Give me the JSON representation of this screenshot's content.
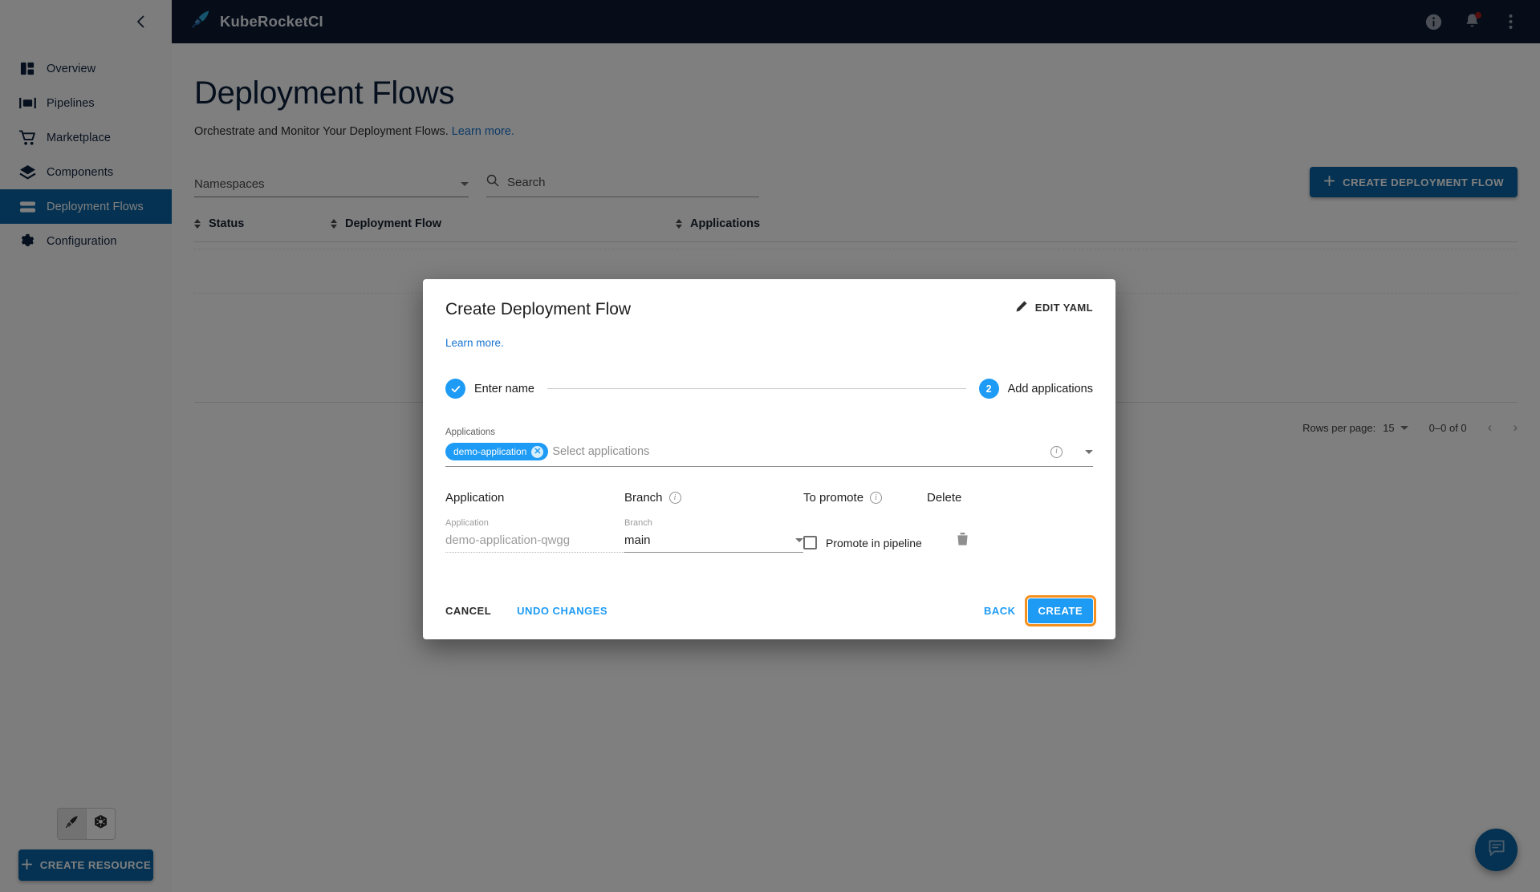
{
  "app": {
    "brand": "KubeRocketCI",
    "brand_icon": "rocket-logo-icon",
    "accent_blue": "#0a64a4",
    "bright_blue": "#1d9bf5",
    "topbar_bg": "#0c1b33",
    "highlight_orange": "#f5901e"
  },
  "topbar": {
    "info_icon": "info-icon",
    "notifications_icon": "bell-icon",
    "overflow_icon": "more-vertical-icon"
  },
  "sidebar": {
    "collapse_icon": "chevron-left-icon",
    "items": [
      {
        "label": "Overview",
        "icon": "dashboard-icon",
        "active": false
      },
      {
        "label": "Pipelines",
        "icon": "pipelines-icon",
        "active": false
      },
      {
        "label": "Marketplace",
        "icon": "cart-icon",
        "active": false
      },
      {
        "label": "Components",
        "icon": "layers-icon",
        "active": false
      },
      {
        "label": "Deployment Flows",
        "icon": "deployment-flows-icon",
        "active": true
      },
      {
        "label": "Configuration",
        "icon": "gear-icon",
        "active": false
      }
    ],
    "mode_toggle": {
      "left_icon": "rocket-mode-icon",
      "right_icon": "kubernetes-mode-icon"
    },
    "create_resource_label": "CREATE RESOURCE",
    "create_resource_icon": "plus-icon"
  },
  "page": {
    "title": "Deployment Flows",
    "subtitle": "Orchestrate and Monitor Your Deployment Flows.",
    "subtitle_link": "Learn more."
  },
  "toolbar": {
    "namespaces_label": "Namespaces",
    "search_placeholder": "Search",
    "search_icon": "search-icon",
    "create_flow_label": "CREATE DEPLOYMENT FLOW",
    "create_flow_icon": "plus-icon"
  },
  "table": {
    "columns": [
      "Status",
      "Deployment Flow",
      "Applications"
    ],
    "rows": []
  },
  "pagination": {
    "rows_per_page_label": "Rows per page:",
    "rows_per_page_value": "15",
    "range": "0–0 of 0",
    "prev_icon": "chevron-left-icon",
    "next_icon": "chevron-right-icon"
  },
  "fab": {
    "icon": "chat-bubble-icon"
  },
  "dialog": {
    "title": "Create Deployment Flow",
    "edit_yaml_label": "EDIT YAML",
    "edit_yaml_icon": "pencil-icon",
    "learn_more": "Learn more.",
    "steps": [
      {
        "index": "1",
        "label": "Enter name",
        "state": "completed",
        "check_icon": "check-icon"
      },
      {
        "index": "2",
        "label": "Add applications",
        "state": "active"
      }
    ],
    "applications_field": {
      "label": "Applications",
      "placeholder": "Select applications",
      "chips": [
        {
          "label": "demo-application",
          "remove_icon": "chip-remove-icon"
        }
      ],
      "info_icon": "info-icon",
      "dropdown_icon": "chevron-down-icon"
    },
    "grid": {
      "headers": [
        {
          "label": "Application",
          "info": false
        },
        {
          "label": "Branch",
          "info": true
        },
        {
          "label": "To promote",
          "info": true
        },
        {
          "label": "Delete",
          "info": false
        }
      ],
      "rows": [
        {
          "application_label": "Application",
          "application_value": "demo-application-qwgg",
          "branch_label": "Branch",
          "branch_value": "main",
          "branch_dropdown_icon": "chevron-down-icon",
          "promote_checked": false,
          "promote_label": "Promote in pipeline",
          "delete_icon": "trash-icon"
        }
      ]
    },
    "footer": {
      "cancel": "CANCEL",
      "undo": "UNDO CHANGES",
      "back": "BACK",
      "create": "CREATE"
    }
  }
}
